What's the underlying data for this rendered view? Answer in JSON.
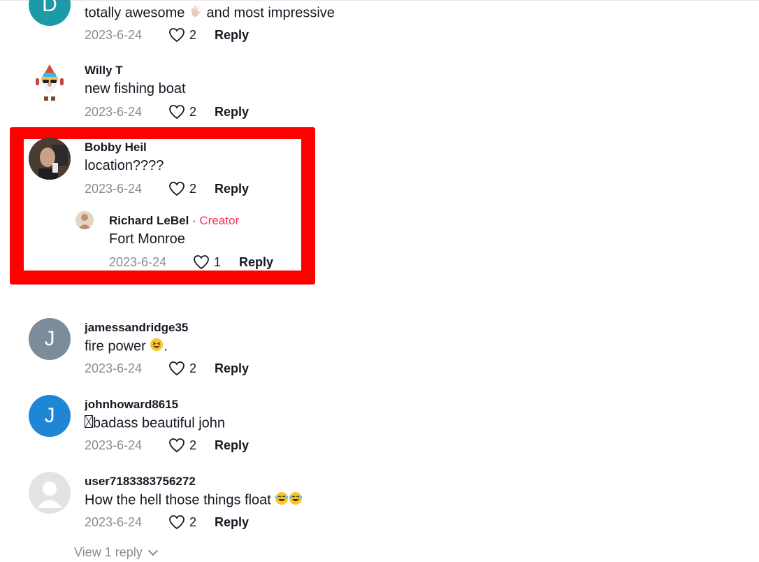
{
  "comments": [
    {
      "avatar_letter": "D",
      "avatar_color": "#1d9aa7",
      "text": "totally awesome",
      "text_after": "and most impressive",
      "date": "2023-6-24",
      "likes": "2",
      "reply_label": "Reply"
    },
    {
      "username": "Willy T",
      "text": "new fishing boat",
      "date": "2023-6-24",
      "likes": "2",
      "reply_label": "Reply"
    },
    {
      "username": "Bobby Heil",
      "text": "location????",
      "date": "2023-6-24",
      "likes": "2",
      "reply_label": "Reply",
      "reply": {
        "username": "Richard LeBel",
        "separator": " · ",
        "creator_label": "Creator",
        "text": "Fort Monroe",
        "date": "2023-6-24",
        "likes": "1",
        "reply_label": "Reply"
      }
    },
    {
      "username": "jamessandridge35",
      "avatar_letter": "J",
      "avatar_color": "#7c8c9b",
      "text": "fire power",
      "text_after": ".",
      "date": "2023-6-24",
      "likes": "2",
      "reply_label": "Reply"
    },
    {
      "username": "johnhoward8615",
      "avatar_letter": "J",
      "avatar_color": "#1f86d6",
      "text": "badass beautiful john",
      "date": "2023-6-24",
      "likes": "2",
      "reply_label": "Reply"
    },
    {
      "username": "user7183383756272",
      "text": "How the hell those things float",
      "date": "2023-6-24",
      "likes": "2",
      "reply_label": "Reply"
    }
  ],
  "view_replies_label": "View 1 reply",
  "highlight_color": "#fe0000",
  "creator_color": "#fe2c55"
}
